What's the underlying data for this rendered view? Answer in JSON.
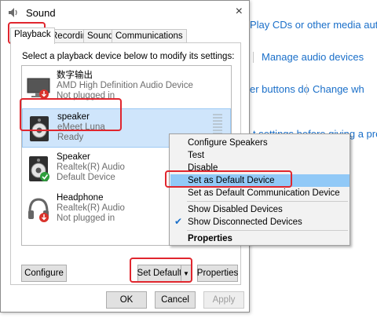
{
  "background": {
    "links": [
      {
        "text": "Play CDs or other media auto"
      },
      {
        "text": "Manage audio devices"
      },
      {
        "text": "er buttons do"
      },
      {
        "text": "Change wh"
      },
      {
        "text": "t settings before giving a prese"
      }
    ]
  },
  "dialog": {
    "title": "Sound",
    "close_glyph": "×",
    "tabs": [
      "Playback",
      "Recording",
      "Sounds",
      "Communications"
    ],
    "instruction": "Select a playback device below to modify its settings:",
    "devices": [
      {
        "name": "数字输出",
        "driver": "AMD High Definition Audio Device",
        "status": "Not plugged in",
        "icon": "monitor-icon",
        "badge": "unplugged-badge"
      },
      {
        "name": "speaker",
        "driver": "eMeet Luna",
        "status": "Ready",
        "icon": "speaker-icon",
        "badge": ""
      },
      {
        "name": "Speaker",
        "driver": "Realtek(R) Audio",
        "status": "Default Device",
        "icon": "speaker-icon",
        "badge": "default-check-badge"
      },
      {
        "name": "Headphone",
        "driver": "Realtek(R) Audio",
        "status": "Not plugged in",
        "icon": "headphone-icon",
        "badge": "unplugged-badge"
      }
    ],
    "buttons": {
      "configure": "Configure",
      "set_default": "Set Default",
      "properties": "Properties",
      "ok": "OK",
      "cancel": "Cancel",
      "apply": "Apply"
    }
  },
  "context_menu": {
    "items": [
      {
        "label": "Configure Speakers"
      },
      {
        "label": "Test"
      },
      {
        "label": "Disable"
      },
      {
        "label": "Set as Default Device"
      },
      {
        "label": "Set as Default Communication Device"
      },
      {
        "label": "Show Disabled Devices"
      },
      {
        "label": "Show Disconnected Devices"
      },
      {
        "label": "Properties"
      }
    ]
  },
  "colors": {
    "highlight_annotation": "#e0262e",
    "selection": "#cfe5fb",
    "menu_hover": "#91c9f7",
    "link": "#1a6fc9"
  }
}
